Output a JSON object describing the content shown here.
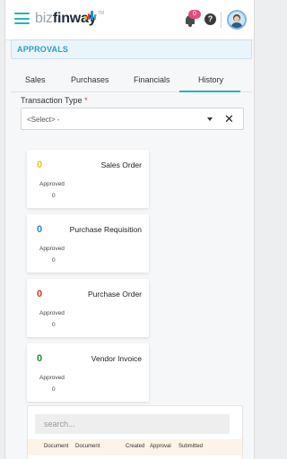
{
  "header": {
    "logo_prefix": "biz",
    "logo_main": "finway",
    "logo_tm": "TM",
    "notification_count": "0",
    "help_label": "?",
    "icons": [
      "hamburger-menu-icon",
      "bell-icon",
      "help-icon",
      "user-avatar"
    ],
    "accent_color": "#25b4b7"
  },
  "breadcrumb": {
    "title": "APPROVALS"
  },
  "tabs": [
    {
      "label": "Sales"
    },
    {
      "label": "Purchases"
    },
    {
      "label": "Financials"
    },
    {
      "label": "History",
      "active": true
    }
  ],
  "filter": {
    "label": "Transaction Type",
    "required_mark": "*",
    "selected": "<Select> -",
    "clear_label": "✕"
  },
  "cards": [
    {
      "count": "0",
      "name": "Sales Order",
      "approved_label": "Approved",
      "approved_value": "0",
      "color": "#f3c316"
    },
    {
      "count": "0",
      "name": "Purchase Requisition",
      "approved_label": "Approved",
      "approved_value": "0",
      "color": "#2e82d6"
    },
    {
      "count": "0",
      "name": "Purchase Order",
      "approved_label": "Approved",
      "approved_value": "0",
      "color": "#d9341e"
    },
    {
      "count": "0",
      "name": "Vendor Invoice",
      "approved_label": "Approved",
      "approved_value": "0",
      "color": "#1f8a3a"
    }
  ],
  "history": {
    "search_placeholder": "search...",
    "columns": [
      "Document",
      "Document",
      "Created",
      "Approval",
      "Submitted"
    ]
  }
}
